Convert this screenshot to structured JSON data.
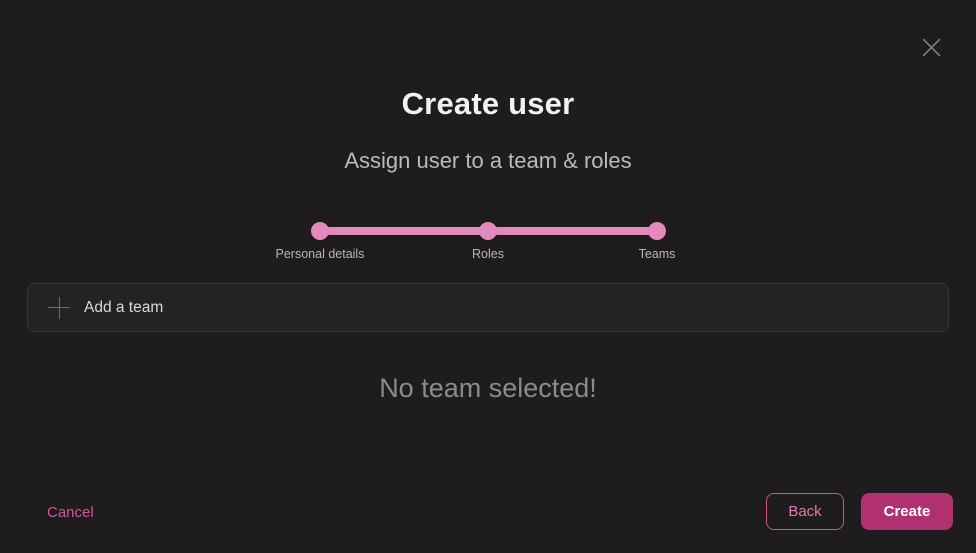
{
  "dialog": {
    "title": "Create user",
    "subtitle": "Assign user to a team & roles",
    "close_icon": "close-icon"
  },
  "stepper": {
    "steps": [
      {
        "label": "Personal details",
        "state": "complete"
      },
      {
        "label": "Roles",
        "state": "complete"
      },
      {
        "label": "Teams",
        "state": "current"
      }
    ],
    "active_color": "#e489bb",
    "label_color": "#b9b5b6"
  },
  "add_team": {
    "label": "Add a team",
    "icon": "plus-icon"
  },
  "empty_state": {
    "message": "No team selected!"
  },
  "footer": {
    "cancel_label": "Cancel",
    "back_label": "Back",
    "create_label": "Create",
    "cancel_color": "#d2569c",
    "back_color": "#e07ab4",
    "create_bg": "#b03070"
  },
  "theme": {
    "background": "#1e1c1d",
    "field_background": "#252223",
    "field_border": "#3a3637",
    "title_color": "#f2f0f0",
    "subtitle_color": "#bdb9ba"
  }
}
